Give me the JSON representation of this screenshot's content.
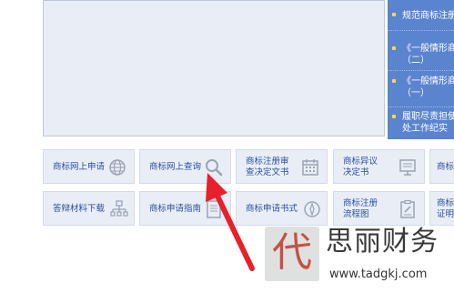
{
  "news": [
    {
      "text": "规范商标注册"
    },
    {
      "text": "《一般情形商\n（二）"
    },
    {
      "text": "《一般情形商\n（一）"
    },
    {
      "text": "履职尽责担使\n处工作纪实"
    }
  ],
  "tiles": [
    {
      "label": "商标网上申请",
      "icon": "globe-icon"
    },
    {
      "label": "商标网上查询",
      "icon": "magnifier-icon"
    },
    {
      "label": "商标注册审\n查决定文书",
      "icon": "calendar-icon"
    },
    {
      "label": "商标异议\n决定书",
      "icon": "presentation-board-icon"
    },
    {
      "label": "商标",
      "icon": "none"
    },
    {
      "label": "答辩材料下载",
      "icon": "org-chart-icon"
    },
    {
      "label": "商标申请指南",
      "icon": "document-icon"
    },
    {
      "label": "商标申请书式",
      "icon": "compass-icon"
    },
    {
      "label": "商标注册\n流程图",
      "icon": "edit-document-icon"
    },
    {
      "label": "商标\n证明",
      "icon": "none"
    }
  ],
  "watermark": {
    "glyph": "代",
    "name": "思丽财务",
    "url": "www.tadgkj.com"
  },
  "colors": {
    "news_bg": "#5b84cf",
    "tile_bg": "#e9eef6",
    "tile_text": "#2d4f9e",
    "arrow": "#e8202a"
  }
}
